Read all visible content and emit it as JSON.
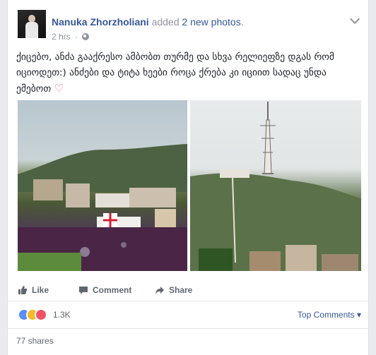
{
  "post": {
    "author": "Nanuka Zhorzholiani",
    "action_prefix": "added",
    "action_link": "2 new photos",
    "action_suffix": ".",
    "time": "2 hrs",
    "text": "ქიცებო, ანძა გააქრესო ამბობთ თურმე და სხვა რელიეფზე დგას რომ იციოდეთ:) ანძები და ტიტა ხეები როცა ქრება კი იციით სადაც უნდა ემებოთ",
    "heart": "♡",
    "icons": {
      "privacy": "globe-icon",
      "menu": "chevron-down-icon",
      "heart": "heart-icon"
    }
  },
  "actions": {
    "like": "Like",
    "comment": "Comment",
    "share": "Share"
  },
  "reactions": {
    "count": "1.3K",
    "top_comments": "Top Comments"
  },
  "shares": {
    "label": "77 shares"
  },
  "colors": {
    "link": "#365899",
    "secondary": "#90949c",
    "like": "#5890ff",
    "haha": "#f7b928",
    "love": "#f25268"
  }
}
